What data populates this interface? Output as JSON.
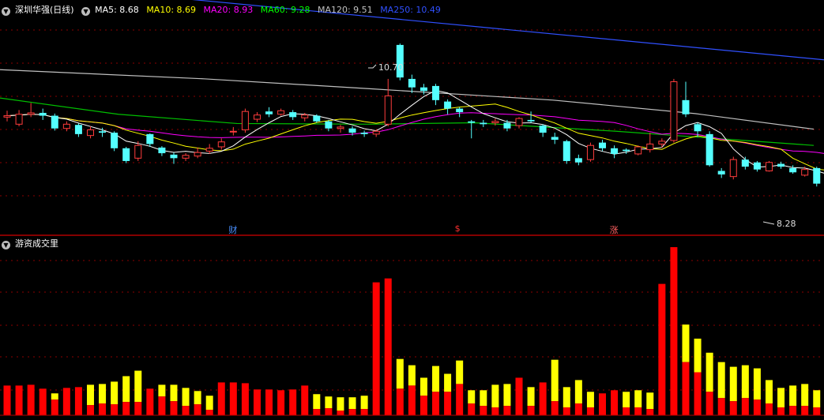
{
  "legend": {
    "stock_name": "深圳华强(日线)",
    "ma": [
      {
        "label": "MA5: 8.68",
        "color": "#ffffff"
      },
      {
        "label": "MA10: 8.69",
        "color": "#ffff00"
      },
      {
        "label": "MA20: 8.93",
        "color": "#ff00ff"
      },
      {
        "label": "MA60: 9.28",
        "color": "#00ff00"
      },
      {
        "label": "MA120: 9.51",
        "color": "#c0c0c0"
      },
      {
        "label": "MA250: 10.49",
        "color": "#3050ff"
      }
    ]
  },
  "volume_panel": {
    "title": "游资成交里"
  },
  "annotations": {
    "high": "10.70",
    "low": "8.28"
  },
  "events": [
    {
      "label": "财",
      "color": "#4a90ff",
      "index": 19
    },
    {
      "label": "$",
      "color": "#ff3030",
      "index": 38
    },
    {
      "label": "涨",
      "color": "#ff6060",
      "index": 51
    }
  ],
  "colors": {
    "up": "#ff3c3c",
    "down": "#54ffff",
    "vol_red": "#ff0000",
    "vol_yellow": "#ffff00",
    "grid": "#8b0000"
  },
  "chart_data": {
    "type": "candlestick",
    "price_range": [
      8.1,
      11.0
    ],
    "candles": [
      [
        9.68,
        9.7,
        9.77,
        9.62
      ],
      [
        9.58,
        9.72,
        9.78,
        9.55
      ],
      [
        9.72,
        9.74,
        9.88,
        9.68
      ],
      [
        9.74,
        9.7,
        9.8,
        9.64
      ],
      [
        9.7,
        9.52,
        9.73,
        9.49
      ],
      [
        9.52,
        9.58,
        9.62,
        9.48
      ],
      [
        9.57,
        9.44,
        9.59,
        9.4
      ],
      [
        9.42,
        9.5,
        9.55,
        9.38
      ],
      [
        9.48,
        9.46,
        9.53,
        9.4
      ],
      [
        9.46,
        9.24,
        9.48,
        9.2
      ],
      [
        9.24,
        9.06,
        9.26,
        9.03
      ],
      [
        9.1,
        9.28,
        9.34,
        9.06
      ],
      [
        9.44,
        9.3,
        9.45,
        9.26
      ],
      [
        9.25,
        9.17,
        9.27,
        9.13
      ],
      [
        9.15,
        9.1,
        9.18,
        9.02
      ],
      [
        9.1,
        9.14,
        9.17,
        9.06
      ],
      [
        9.13,
        9.18,
        9.25,
        9.1
      ],
      [
        9.2,
        9.24,
        9.3,
        9.16
      ],
      [
        9.26,
        9.33,
        9.38,
        9.22
      ],
      [
        9.48,
        9.48,
        9.54,
        9.42
      ],
      [
        9.5,
        9.76,
        9.8,
        9.46
      ],
      [
        9.65,
        9.71,
        9.75,
        9.61
      ],
      [
        9.76,
        9.72,
        9.82,
        9.68
      ],
      [
        9.72,
        9.77,
        9.8,
        9.7
      ],
      [
        9.75,
        9.68,
        9.78,
        9.64
      ],
      [
        9.67,
        9.71,
        9.74,
        9.62
      ],
      [
        9.7,
        9.62,
        9.72,
        9.6
      ],
      [
        9.62,
        9.52,
        9.64,
        9.48
      ],
      [
        9.52,
        9.54,
        9.57,
        9.46
      ],
      [
        9.52,
        9.46,
        9.55,
        9.42
      ],
      [
        9.46,
        9.44,
        9.49,
        9.4
      ],
      [
        9.44,
        9.48,
        9.5,
        9.4
      ],
      [
        9.58,
        9.98,
        10.22,
        9.55
      ],
      [
        10.7,
        10.24,
        10.72,
        10.2
      ],
      [
        10.22,
        10.1,
        10.28,
        10.02
      ],
      [
        10.1,
        10.05,
        10.15,
        10.0
      ],
      [
        10.12,
        9.92,
        10.15,
        9.85
      ],
      [
        9.9,
        9.8,
        9.93,
        9.72
      ],
      [
        9.8,
        9.75,
        9.82,
        9.68
      ],
      [
        9.62,
        9.6,
        9.64,
        9.38
      ],
      [
        9.6,
        9.58,
        9.64,
        9.54
      ],
      [
        9.6,
        9.62,
        9.66,
        9.56
      ],
      [
        9.6,
        9.52,
        9.64,
        9.48
      ],
      [
        9.56,
        9.66,
        9.68,
        9.52
      ],
      [
        9.64,
        9.62,
        9.76,
        9.6
      ],
      [
        9.56,
        9.46,
        9.58,
        9.4
      ],
      [
        9.4,
        9.36,
        9.46,
        9.3
      ],
      [
        9.34,
        9.06,
        9.36,
        9.02
      ],
      [
        9.1,
        9.04,
        9.15,
        9.0
      ],
      [
        9.08,
        9.28,
        9.32,
        9.05
      ],
      [
        9.32,
        9.24,
        9.36,
        9.2
      ],
      [
        9.24,
        9.16,
        9.28,
        9.1
      ],
      [
        9.22,
        9.2,
        9.24,
        9.16
      ],
      [
        9.16,
        9.26,
        9.28,
        9.14
      ],
      [
        9.22,
        9.3,
        9.46,
        9.18
      ],
      [
        9.3,
        9.34,
        9.38,
        9.25
      ],
      [
        9.35,
        10.18,
        10.22,
        9.32
      ],
      [
        9.92,
        9.72,
        10.18,
        9.68
      ],
      [
        9.58,
        9.48,
        9.6,
        9.4
      ],
      [
        9.44,
        9.0,
        9.48,
        8.98
      ],
      [
        8.92,
        8.87,
        8.96,
        8.82
      ],
      [
        8.84,
        9.08,
        9.12,
        8.8
      ],
      [
        9.08,
        8.98,
        9.12,
        8.94
      ],
      [
        9.04,
        8.94,
        9.06,
        8.91
      ],
      [
        8.92,
        9.04,
        9.06,
        8.91
      ],
      [
        9.02,
        8.98,
        9.05,
        8.95
      ],
      [
        8.96,
        8.9,
        9.0,
        8.88
      ],
      [
        8.86,
        8.94,
        8.98,
        8.84
      ],
      [
        8.96,
        8.74,
        8.98,
        8.7
      ],
      [
        8.7,
        8.78,
        8.82,
        8.68
      ],
      [
        8.76,
        8.44,
        8.78,
        8.42
      ],
      [
        8.46,
        8.7,
        8.74,
        8.28
      ],
      [
        8.7,
        8.64,
        8.76,
        8.6
      ],
      [
        8.72,
        8.84,
        8.86,
        8.7
      ],
      [
        8.8,
        8.86,
        8.9,
        8.78
      ]
    ],
    "volume": {
      "y_range": [
        0,
        210
      ],
      "total": [
        38,
        38,
        39,
        34,
        28,
        35,
        36,
        39,
        40,
        43,
        50,
        57,
        34,
        39,
        39,
        35,
        31,
        25,
        42,
        42,
        41,
        33,
        33,
        32,
        33,
        38,
        27,
        24,
        23,
        23,
        25,
        170,
        175,
        72,
        64,
        48,
        63,
        53,
        70,
        32,
        32,
        39,
        40,
        48,
        36,
        42,
        71,
        36,
        45,
        30,
        28,
        32,
        30,
        32,
        29,
        168,
        215,
        116,
        98,
        80,
        68,
        62,
        64,
        60,
        45,
        35,
        38,
        40,
        32,
        38,
        57,
        39,
        38,
        37
      ],
      "red": [
        38,
        38,
        39,
        34,
        20,
        35,
        36,
        13,
        15,
        14,
        17,
        17,
        34,
        24,
        18,
        12,
        14,
        7,
        42,
        42,
        41,
        33,
        33,
        32,
        33,
        38,
        8,
        9,
        6,
        8,
        8,
        170,
        175,
        34,
        38,
        25,
        30,
        30,
        40,
        15,
        12,
        10,
        12,
        48,
        12,
        42,
        18,
        10,
        15,
        10,
        30,
        32,
        10,
        10,
        8,
        168,
        215,
        68,
        55,
        30,
        22,
        18,
        22,
        20,
        15,
        10,
        12,
        12,
        10,
        12,
        30,
        15,
        38,
        14
      ]
    }
  }
}
